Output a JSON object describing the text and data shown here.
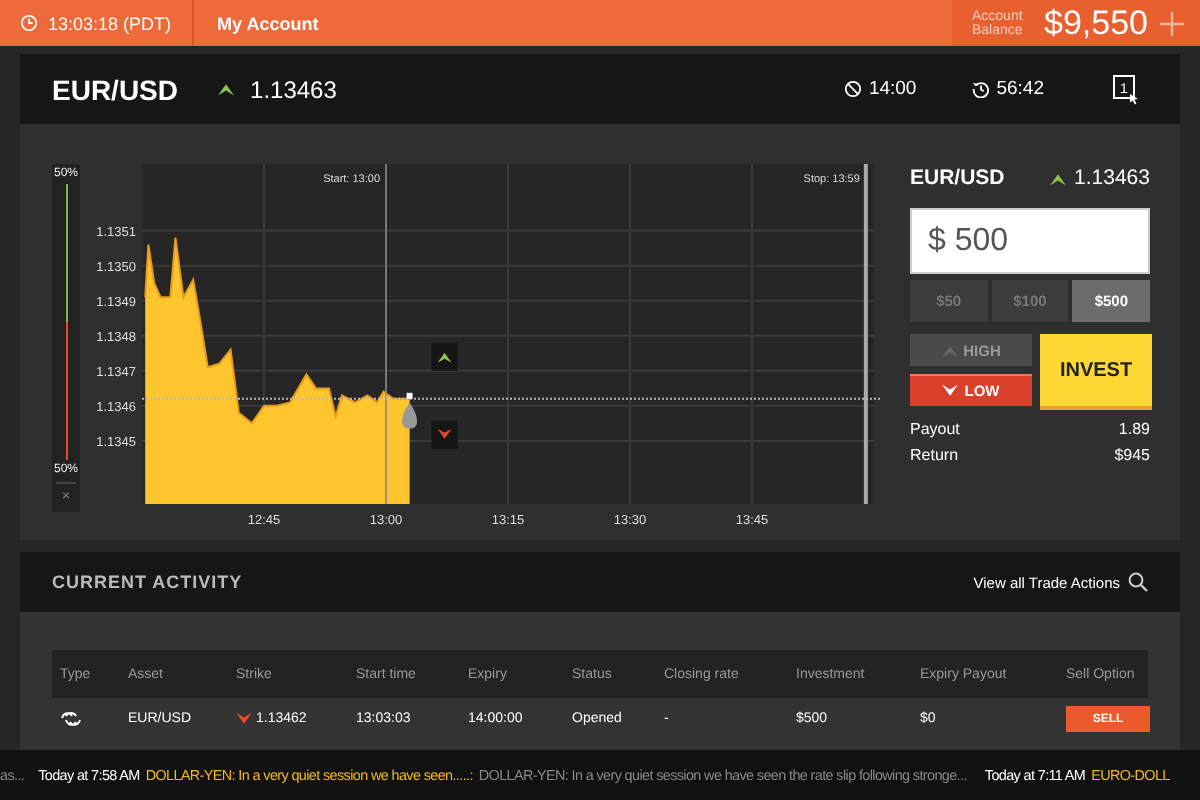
{
  "top_bar": {
    "clock": "13:03:18 (PDT)",
    "account_link": "My Account",
    "balance_label": "Account Balance",
    "balance": "$9,550"
  },
  "asset_header": {
    "pair": "EUR/USD",
    "rate": "1.13463",
    "expiry": "14:00",
    "countdown": "56:42",
    "layout_button": "1"
  },
  "meter": {
    "top_label": "50%",
    "bottom_label": "50%",
    "level": 0.5,
    "close": "×"
  },
  "chart": {
    "stop_label": "Stop: 13:59",
    "chart_data": {
      "type": "area",
      "x": [
        12.5067,
        12.5133,
        12.525,
        12.5383,
        12.5583,
        12.5683,
        12.585,
        12.605,
        12.6183,
        12.635,
        12.6583,
        12.6817,
        12.6983,
        12.725,
        12.75,
        12.7767,
        12.8033,
        12.8367,
        12.8567,
        12.8833,
        12.8967,
        12.91,
        12.9367,
        12.9617,
        12.9817,
        12.995,
        13.015,
        13.0483
      ],
      "series": [
        {
          "color": "#fec52e",
          "values": [
            1.13491,
            1.13506,
            1.13495,
            1.13491,
            1.13491,
            1.13508,
            1.13491,
            1.13496,
            1.13485,
            1.13471,
            1.13472,
            1.13476,
            1.13458,
            1.13455,
            1.1346,
            1.1346,
            1.13461,
            1.13469,
            1.13465,
            1.13465,
            1.13457,
            1.13463,
            1.13461,
            1.13463,
            1.13461,
            1.13464,
            1.13462,
            1.13462
          ]
        }
      ],
      "xlim": [
        12.5,
        14
      ],
      "ylim": [
        1.13432,
        1.13529
      ],
      "xticks": [
        {
          "value": 12.75,
          "label": "12:45"
        },
        {
          "value": 13,
          "label": "13:00"
        },
        {
          "value": 13.25,
          "label": "13:15"
        },
        {
          "value": 13.5,
          "label": "13:30"
        },
        {
          "value": 13.75,
          "label": "13:45"
        }
      ],
      "yticks": [
        1.1345,
        1.1346,
        1.1347,
        1.1348,
        1.1349,
        {
          "value": 1.135,
          "label": "1.1350"
        },
        1.1351
      ],
      "grid": true,
      "ref_lines": [
        {
          "axis": "x",
          "value": 13,
          "label": "Start: 13:00"
        },
        {
          "axis": "x",
          "value": 13.9833
        },
        {
          "axis": "y",
          "value": 1.13462
        }
      ]
    }
  },
  "trade_panel": {
    "pair": "EUR/USD",
    "rate": "1.13463",
    "amount": "$ 500",
    "presets": [
      {
        "label": "$50",
        "selected": false
      },
      {
        "label": "$100",
        "selected": false
      },
      {
        "label": "$500",
        "selected": true
      }
    ],
    "directions": [
      {
        "kind": "up",
        "label": "HIGH",
        "selected": false
      },
      {
        "kind": "down",
        "label": "LOW",
        "selected": true
      }
    ],
    "invest": "INVEST",
    "stats": [
      {
        "label": "Payout",
        "value": "1.89"
      },
      {
        "label": "Return",
        "value": "$945"
      }
    ]
  },
  "activity": {
    "title": "CURRENT ACTIVITY",
    "view_all": "View all Trade Actions",
    "columns": [
      "Type",
      "Asset",
      "Strike",
      "Start time",
      "Expiry",
      "Status",
      "Closing rate",
      "Investment",
      "Expiry Payout",
      "Sell Option"
    ],
    "rows": [
      {
        "kind": "down",
        "asset": "EUR/USD",
        "strike": "1.13462",
        "start_time": "13:03:03",
        "expiry": "14:00:00",
        "status": "Opened",
        "closing_rate": "-",
        "investment": "$500",
        "expiry_payout": "$0",
        "action": "SELL"
      }
    ]
  },
  "ticker": {
    "lead": "as...",
    "items": [
      {
        "time": "Today at 7:58 AM",
        "headline": "DOLLAR-YEN: In a very quiet session we have seen.....:",
        "summary": "DOLLAR-YEN: In a very quiet session we have seen the rate slip following stronge..."
      },
      {
        "time": "Today at 7:11 AM",
        "headline": "EURO-DOLL"
      }
    ]
  }
}
